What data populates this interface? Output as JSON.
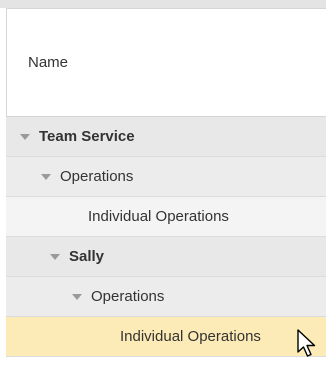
{
  "header": {
    "name_column_label": "Name"
  },
  "tree": {
    "rows": [
      {
        "label": "Team Service",
        "level": 0,
        "expanded": true
      },
      {
        "label": "Operations",
        "level": 1,
        "expanded": true
      },
      {
        "label": "Individual Operations",
        "level": 2,
        "expanded": false
      },
      {
        "label": "Sally",
        "level": 1,
        "expanded": true
      },
      {
        "label": "Operations",
        "level": 2,
        "expanded": true
      },
      {
        "label": "Individual Operations",
        "level": 3,
        "expanded": false,
        "selected": true
      }
    ]
  },
  "colors": {
    "accent_bar": "#3f8f41",
    "selected_row": "#fcebb6",
    "group_row": "#e8e8e8"
  },
  "icons": {
    "expand": "triangle-down-icon",
    "pointer": "mouse-cursor-icon"
  }
}
